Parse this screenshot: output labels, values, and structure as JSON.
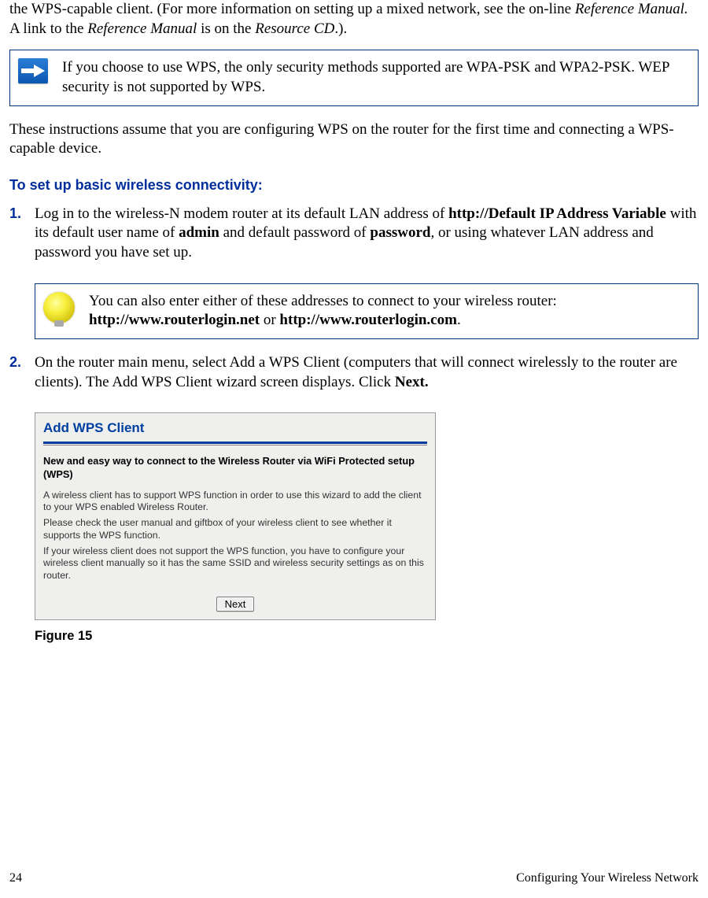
{
  "intro": {
    "p1_a": "the WPS-capable client. (For more information on setting up a mixed network, see the on-line ",
    "p1_b": "Reference Manual.",
    "p1_c": " A link to the ",
    "p1_d": "Reference Manual",
    "p1_e": " is on the ",
    "p1_f": "Resource CD",
    "p1_g": ".)."
  },
  "callout1": "If you choose to use WPS, the only security methods supported are WPA-PSK and WPA2-PSK. WEP security is not supported by WPS.",
  "p2": "These instructions assume that you are configuring WPS on the router for the first time and connecting a WPS-capable device.",
  "heading": "To set up basic wireless connectivity:",
  "step1": {
    "num": "1.",
    "a": "Log in to the wireless-N modem router at its default LAN address of ",
    "b": "http://Default IP Address Variable",
    "c": " with its default user name of ",
    "d": "admin",
    "e": " and default password of ",
    "f": "password",
    "g": ", or using whatever LAN address and password you have set up."
  },
  "callout2": {
    "a": "You can also enter either of these addresses to connect to your wireless router: ",
    "b": "http://www.routerlogin.net",
    "c": " or ",
    "d": "http://www.routerlogin.com",
    "e": "."
  },
  "step2": {
    "num": "2.",
    "a": "On the router main menu, select Add a WPS Client (computers that will connect wirelessly to the router are clients). The Add WPS Client wizard screen displays. Click ",
    "b": "Next."
  },
  "screenshot": {
    "title": "Add WPS Client",
    "subhead": "New and easy way to connect to the Wireless Router via WiFi Protected setup (WPS)",
    "para1": "A wireless client has to support WPS function in order to use this wizard to add the client to your WPS enabled Wireless Router.",
    "para2": "Please check the user manual and giftbox of your wireless client to see whether it supports the WPS function.",
    "para3": "If your wireless client does not support the WPS function, you have to configure your wireless client manually so it has the same SSID and wireless security settings as on this router.",
    "next": "Next"
  },
  "figure": "Figure 15",
  "footer": {
    "page": "24",
    "chapter": "Configuring Your Wireless Network"
  }
}
